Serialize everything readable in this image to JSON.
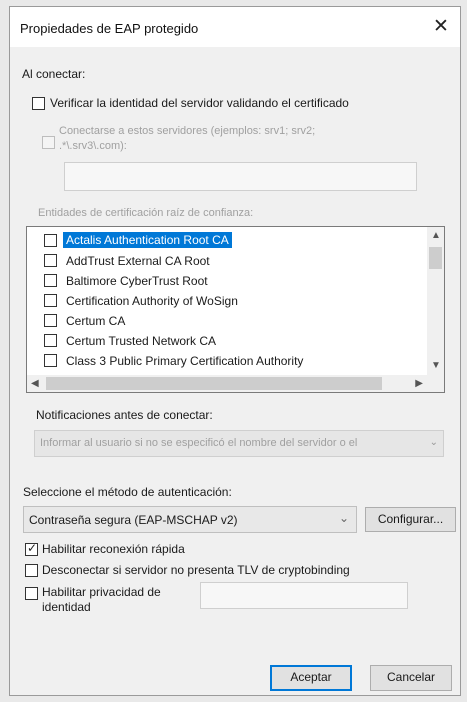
{
  "dialog": {
    "title": "Propiedades de EAP protegido",
    "close_glyph": "✕"
  },
  "connect": {
    "heading": "Al conectar:",
    "verify_label": "Verificar la identidad del servidor validando el certificado",
    "verify_checked": false,
    "servers_label_line1": "Conectarse a estos servidores (ejemplos: srv1; srv2;",
    "servers_label_line2": ".*\\.srv3\\.com):",
    "servers_value": "",
    "ca_heading": "Entidades de certificación raíz de confianza:"
  },
  "ca_list": {
    "items": [
      {
        "label": "Actalis Authentication Root CA",
        "checked": false,
        "selected": true
      },
      {
        "label": "AddTrust External CA Root",
        "checked": false,
        "selected": false
      },
      {
        "label": "Baltimore CyberTrust Root",
        "checked": false,
        "selected": false
      },
      {
        "label": "Certification Authority of WoSign",
        "checked": false,
        "selected": false
      },
      {
        "label": "Certum CA",
        "checked": false,
        "selected": false
      },
      {
        "label": "Certum Trusted Network CA",
        "checked": false,
        "selected": false
      },
      {
        "label": "Class 3 Public Primary Certification Authority",
        "checked": false,
        "selected": false
      }
    ],
    "scroll_up_glyph": "▲",
    "scroll_down_glyph": "▼",
    "scroll_left_glyph": "◀",
    "scroll_right_glyph": "▶"
  },
  "notifications": {
    "label": "Notificaciones antes de conectar:",
    "selected": "Informar al usuario si no se especificó el nombre del servidor o el"
  },
  "auth": {
    "label": "Seleccione el método de autenticación:",
    "selected": "Contraseña segura (EAP-MSCHAP v2)",
    "configure_label": "Configurar...",
    "fast_reconnect_label": "Habilitar reconexión rápida",
    "fast_reconnect_checked": true,
    "disconnect_label": "Desconectar si servidor no presenta TLV de cryptobinding",
    "disconnect_checked": false,
    "privacy_label_line1": "Habilitar privacidad de",
    "privacy_label_line2": "identidad",
    "privacy_checked": false,
    "privacy_value": ""
  },
  "buttons": {
    "ok_label": "Aceptar",
    "cancel_label": "Cancelar"
  },
  "colors": {
    "accent": "#0078d7",
    "dialog_bg": "#f0f0f0"
  },
  "icons": {
    "dropdown": "chevron-down-icon"
  }
}
